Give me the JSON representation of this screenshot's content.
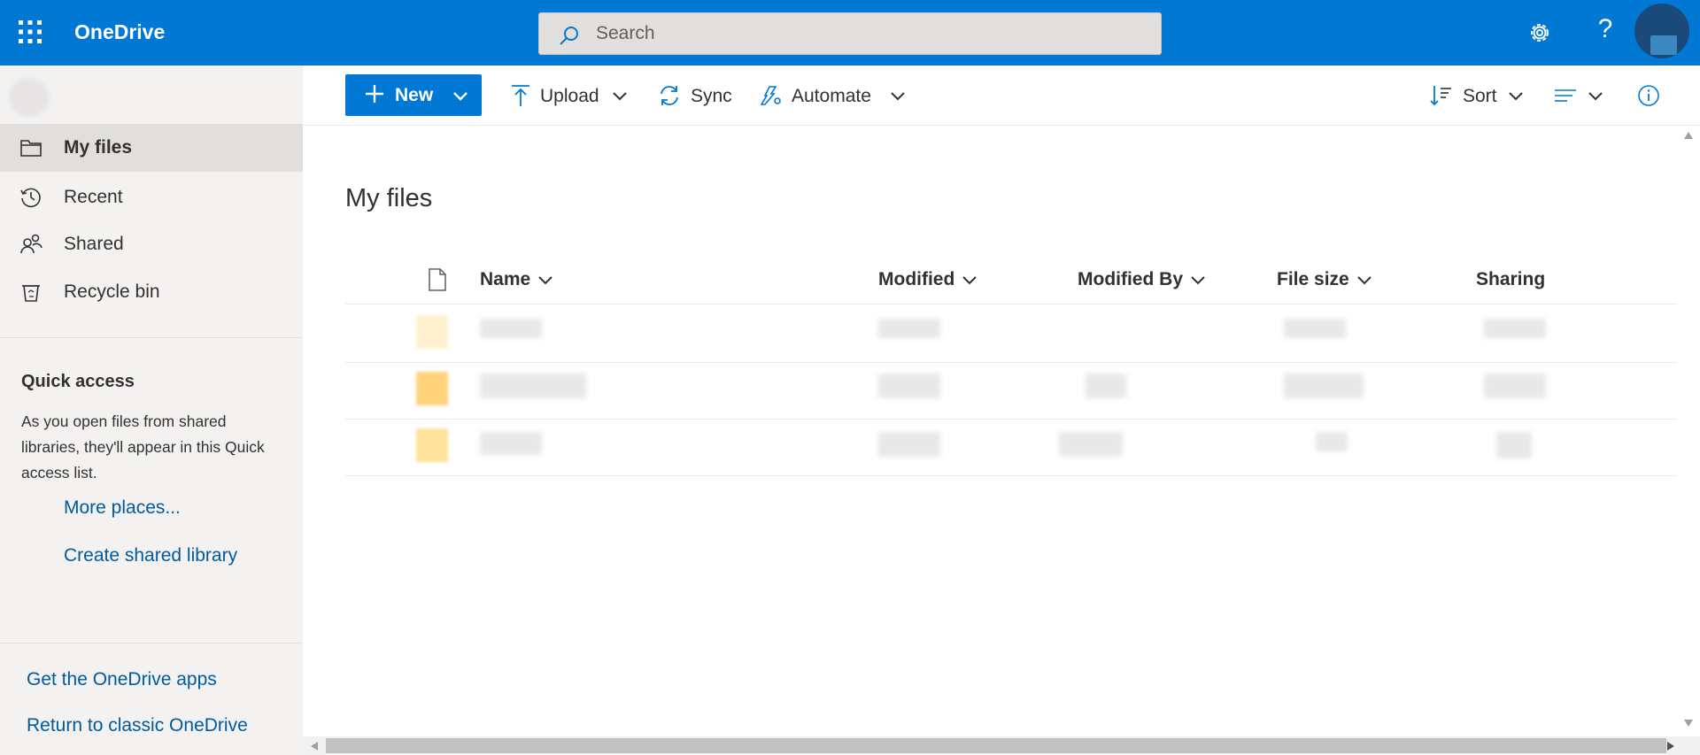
{
  "app": {
    "title": "OneDrive"
  },
  "search": {
    "placeholder": "Search"
  },
  "header": {
    "help_glyph": "?"
  },
  "leftnav": {
    "items": [
      {
        "label": "My files",
        "icon": "folder-icon",
        "active": true
      },
      {
        "label": "Recent",
        "icon": "clock-icon",
        "active": false
      },
      {
        "label": "Shared",
        "icon": "people-icon",
        "active": false
      },
      {
        "label": "Recycle bin",
        "icon": "recycle-bin-icon",
        "active": false
      }
    ],
    "quick_access": {
      "title": "Quick access",
      "description": "As you open files from shared libraries, they'll appear in this Quick access list.",
      "links": [
        "More places...",
        "Create shared library"
      ]
    },
    "footer_links": [
      "Get the OneDrive apps",
      "Return to classic OneDrive"
    ]
  },
  "toolbar": {
    "new_label": "New",
    "upload_label": "Upload",
    "sync_label": "Sync",
    "automate_label": "Automate",
    "sort_label": "Sort"
  },
  "main": {
    "title": "My files",
    "columns": [
      "Name",
      "Modified",
      "Modified By",
      "File size",
      "Sharing"
    ]
  },
  "colors": {
    "accent": "#0078d4",
    "nav_bg": "#f3f2f1",
    "link": "#005a9e",
    "folder": "#ffd37a"
  }
}
